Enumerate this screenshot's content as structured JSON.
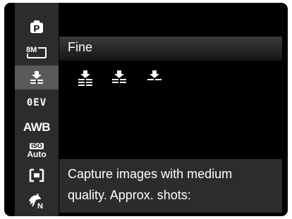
{
  "sidebar": {
    "items": [
      {
        "name": "scene-mode-program",
        "label": "P"
      },
      {
        "name": "image-size",
        "label": "8M"
      },
      {
        "name": "image-quality"
      },
      {
        "name": "exposure-compensation",
        "label": "0EV"
      },
      {
        "name": "white-balance",
        "label": "AWB"
      },
      {
        "name": "iso",
        "label_top": "ISO",
        "label_bottom": "Auto"
      },
      {
        "name": "metering",
        "label": ""
      },
      {
        "name": "color-mode",
        "label": "N"
      }
    ]
  },
  "quality_menu": {
    "selected_label": "Fine",
    "options": [
      "super-fine-icon",
      "fine-icon",
      "normal-icon"
    ]
  },
  "description": {
    "line1": "Capture images with medium",
    "line2": "quality. Approx. shots:"
  }
}
